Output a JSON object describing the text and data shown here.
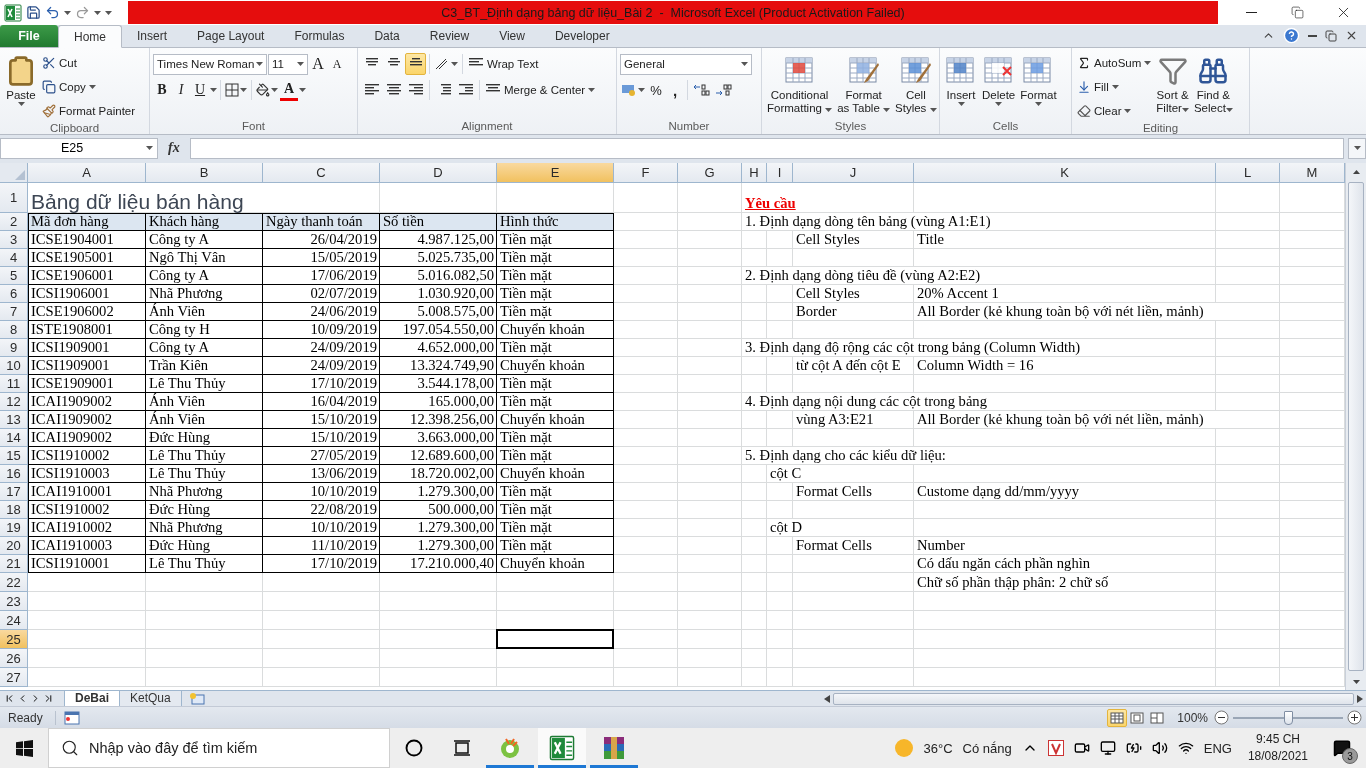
{
  "title_bar": {
    "title": "C3_BT_Định dạng bảng dữ liệu_Bài 2  -  Microsoft Excel (Product Activation Failed)"
  },
  "ribbon_tabs": [
    {
      "label": "File",
      "kind": "file",
      "selected": false
    },
    {
      "label": "Home",
      "kind": "tab",
      "selected": true
    },
    {
      "label": "Insert",
      "kind": "tab",
      "selected": false
    },
    {
      "label": "Page Layout",
      "kind": "tab",
      "selected": false
    },
    {
      "label": "Formulas",
      "kind": "tab",
      "selected": false
    },
    {
      "label": "Data",
      "kind": "tab",
      "selected": false
    },
    {
      "label": "Review",
      "kind": "tab",
      "selected": false
    },
    {
      "label": "View",
      "kind": "tab",
      "selected": false
    },
    {
      "label": "Developer",
      "kind": "tab",
      "selected": false
    }
  ],
  "ribbon": {
    "clipboard": {
      "label": "Clipboard",
      "paste": "Paste",
      "cut": "Cut",
      "copy": "Copy",
      "format_painter": "Format Painter"
    },
    "font": {
      "label": "Font",
      "font_name": "Times New Roman",
      "font_size": "11",
      "grow": "A",
      "shrink": "A",
      "bold": "B",
      "italic": "I",
      "underline": "U",
      "font_color": "A"
    },
    "alignment": {
      "label": "Alignment",
      "wrap_text": "Wrap Text",
      "merge": "Merge & Center",
      "vertical": [
        {
          "selected": false
        },
        {
          "selected": false
        },
        {
          "selected": true
        }
      ]
    },
    "number": {
      "label": "Number",
      "format": "General",
      "percent": "%",
      "comma": ","
    },
    "styles": {
      "label": "Styles",
      "buttons": [
        {
          "kind": "conditional",
          "lines": [
            "Conditional",
            "Formatting"
          ]
        },
        {
          "kind": "table",
          "lines": [
            "Format",
            "as Table"
          ]
        },
        {
          "kind": "cell",
          "lines": [
            "Cell",
            "Styles"
          ]
        }
      ]
    },
    "cells": {
      "label": "Cells",
      "buttons": [
        {
          "kind": "insert",
          "label": "Insert"
        },
        {
          "kind": "delete",
          "label": "Delete"
        },
        {
          "kind": "format",
          "label": "Format"
        }
      ]
    },
    "editing": {
      "label": "Editing",
      "autosum": "AutoSum",
      "fill": "Fill",
      "clear": "Clear",
      "buttons": [
        {
          "kind": "sort",
          "lines": [
            "Sort &",
            "Filter"
          ]
        },
        {
          "kind": "find",
          "lines": [
            "Find &",
            "Select"
          ]
        }
      ]
    }
  },
  "formula_bar": {
    "name_box": "E25",
    "function_label": "fx"
  },
  "sheet": {
    "columns": [
      {
        "label": "A",
        "selected": false
      },
      {
        "label": "B",
        "selected": false
      },
      {
        "label": "C",
        "selected": false
      },
      {
        "label": "D",
        "selected": false
      },
      {
        "label": "E",
        "selected": true
      },
      {
        "label": "F",
        "selected": false
      },
      {
        "label": "G",
        "selected": false
      },
      {
        "label": "H",
        "selected": false
      },
      {
        "label": "I",
        "selected": false
      },
      {
        "label": "J",
        "selected": false
      },
      {
        "label": "K",
        "selected": false
      },
      {
        "label": "L",
        "selected": false
      },
      {
        "label": "M",
        "selected": false
      }
    ],
    "rows": [
      {
        "number": "1",
        "selected": false,
        "cells": [
          {
            "kind": "title",
            "text": "Bảng dữ liệu bán hàng"
          },
          null,
          null,
          null,
          null,
          null,
          null,
          {
            "kind": "heading",
            "text": "Yêu cầu"
          }
        ]
      },
      {
        "number": "2",
        "selected": false,
        "cells": [
          {
            "kind": "header",
            "text": "Mã đơn hàng"
          },
          {
            "kind": "header",
            "text": "Khách hàng"
          },
          {
            "kind": "header",
            "text": "Ngày thanh toán"
          },
          {
            "kind": "header",
            "text": "Số tiền"
          },
          {
            "kind": "header",
            "text": "Hình thức"
          },
          null,
          null,
          {
            "kind": "note",
            "text": "1. Định dạng dòng tên bảng (vùng A1:E1)"
          }
        ]
      },
      {
        "number": "3",
        "selected": false,
        "cells": [
          {
            "kind": "text",
            "text": "ICSE1904001"
          },
          {
            "kind": "text",
            "text": "Công ty A"
          },
          {
            "kind": "number",
            "text": "26/04/2019"
          },
          {
            "kind": "number",
            "text": "4.987.125,00"
          },
          {
            "kind": "text",
            "text": "Tiền mặt"
          },
          null,
          null,
          null,
          null,
          {
            "kind": "note",
            "text": "Cell Styles"
          },
          {
            "kind": "note",
            "text": "Title"
          }
        ]
      },
      {
        "number": "4",
        "selected": false,
        "cells": [
          {
            "kind": "text",
            "text": "ICSE1905001"
          },
          {
            "kind": "text",
            "text": "Ngô Thị Vân"
          },
          {
            "kind": "number",
            "text": "15/05/2019"
          },
          {
            "kind": "number",
            "text": "5.025.735,00"
          },
          {
            "kind": "text",
            "text": "Tiền mặt"
          }
        ]
      },
      {
        "number": "5",
        "selected": false,
        "cells": [
          {
            "kind": "text",
            "text": "ICSE1906001"
          },
          {
            "kind": "text",
            "text": "Công ty A"
          },
          {
            "kind": "number",
            "text": "17/06/2019"
          },
          {
            "kind": "number",
            "text": "5.016.082,50"
          },
          {
            "kind": "text",
            "text": "Tiền mặt"
          },
          null,
          null,
          {
            "kind": "note",
            "text": "2. Định dạng dòng tiêu đề (vùng A2:E2)"
          }
        ]
      },
      {
        "number": "6",
        "selected": false,
        "cells": [
          {
            "kind": "text",
            "text": "ICSI1906001"
          },
          {
            "kind": "text",
            "text": "Nhã Phương"
          },
          {
            "kind": "number",
            "text": "02/07/2019"
          },
          {
            "kind": "number",
            "text": "1.030.920,00"
          },
          {
            "kind": "text",
            "text": "Tiền mặt"
          },
          null,
          null,
          null,
          null,
          {
            "kind": "note",
            "text": "Cell Styles"
          },
          {
            "kind": "note",
            "text": "20% Accent 1"
          }
        ]
      },
      {
        "number": "7",
        "selected": false,
        "cells": [
          {
            "kind": "text",
            "text": "ICSE1906002"
          },
          {
            "kind": "text",
            "text": "Ánh Viên"
          },
          {
            "kind": "number",
            "text": "24/06/2019"
          },
          {
            "kind": "number",
            "text": "5.008.575,00"
          },
          {
            "kind": "text",
            "text": "Tiền mặt"
          },
          null,
          null,
          null,
          null,
          {
            "kind": "note",
            "text": "Border"
          },
          {
            "kind": "note",
            "text": "All Border (kẻ khung toàn bộ với nét liền, mảnh)"
          }
        ]
      },
      {
        "number": "8",
        "selected": false,
        "cells": [
          {
            "kind": "text",
            "text": "ISTE1908001"
          },
          {
            "kind": "text",
            "text": "Công ty H"
          },
          {
            "kind": "number",
            "text": "10/09/2019"
          },
          {
            "kind": "number",
            "text": "197.054.550,00"
          },
          {
            "kind": "text",
            "text": "Chuyển khoản"
          }
        ]
      },
      {
        "number": "9",
        "selected": false,
        "cells": [
          {
            "kind": "text",
            "text": "ICSI1909001"
          },
          {
            "kind": "text",
            "text": "Công ty A"
          },
          {
            "kind": "number",
            "text": "24/09/2019"
          },
          {
            "kind": "number",
            "text": "4.652.000,00"
          },
          {
            "kind": "text",
            "text": "Tiền mặt"
          },
          null,
          null,
          {
            "kind": "note",
            "text": "3. Định dạng độ rộng các cột trong bảng (Column Width)"
          }
        ]
      },
      {
        "number": "10",
        "selected": false,
        "cells": [
          {
            "kind": "text",
            "text": "ICSI1909001"
          },
          {
            "kind": "text",
            "text": "Trần Kiên"
          },
          {
            "kind": "number",
            "text": "24/09/2019"
          },
          {
            "kind": "number",
            "text": "13.324.749,90"
          },
          {
            "kind": "text",
            "text": "Chuyển khoản"
          },
          null,
          null,
          null,
          null,
          {
            "kind": "note",
            "text": "từ cột A đến cột E"
          },
          {
            "kind": "note",
            "text": "Column Width = 16"
          }
        ]
      },
      {
        "number": "11",
        "selected": false,
        "cells": [
          {
            "kind": "text",
            "text": "ICSE1909001"
          },
          {
            "kind": "text",
            "text": "Lê Thu Thủy"
          },
          {
            "kind": "number",
            "text": "17/10/2019"
          },
          {
            "kind": "number",
            "text": "3.544.178,00"
          },
          {
            "kind": "text",
            "text": "Tiền mặt"
          }
        ]
      },
      {
        "number": "12",
        "selected": false,
        "cells": [
          {
            "kind": "text",
            "text": "ICAI1909002"
          },
          {
            "kind": "text",
            "text": "Ánh Viên"
          },
          {
            "kind": "number",
            "text": "16/04/2019"
          },
          {
            "kind": "number",
            "text": "165.000,00"
          },
          {
            "kind": "text",
            "text": "Tiền mặt"
          },
          null,
          null,
          {
            "kind": "note",
            "text": "4. Định dạng nội dung các cột trong bảng"
          }
        ]
      },
      {
        "number": "13",
        "selected": false,
        "cells": [
          {
            "kind": "text",
            "text": "ICAI1909002"
          },
          {
            "kind": "text",
            "text": "Ánh Viên"
          },
          {
            "kind": "number",
            "text": "15/10/2019"
          },
          {
            "kind": "number",
            "text": "12.398.256,00"
          },
          {
            "kind": "text",
            "text": "Chuyển khoản"
          },
          null,
          null,
          null,
          null,
          {
            "kind": "note",
            "text": "vùng A3:E21"
          },
          {
            "kind": "note",
            "text": "All Border (kẻ khung toàn bộ với nét liền, mảnh)"
          }
        ]
      },
      {
        "number": "14",
        "selected": false,
        "cells": [
          {
            "kind": "text",
            "text": "ICAI1909002"
          },
          {
            "kind": "text",
            "text": "Đức Hùng"
          },
          {
            "kind": "number",
            "text": "15/10/2019"
          },
          {
            "kind": "number",
            "text": "3.663.000,00"
          },
          {
            "kind": "text",
            "text": "Tiền mặt"
          }
        ]
      },
      {
        "number": "15",
        "selected": false,
        "cells": [
          {
            "kind": "text",
            "text": "ICSI1910002"
          },
          {
            "kind": "text",
            "text": "Lê Thu Thủy"
          },
          {
            "kind": "number",
            "text": "27/05/2019"
          },
          {
            "kind": "number",
            "text": "12.689.600,00"
          },
          {
            "kind": "text",
            "text": "Tiền mặt"
          },
          null,
          null,
          {
            "kind": "note",
            "text": "5. Định dạng cho các kiểu dữ liệu:"
          }
        ]
      },
      {
        "number": "16",
        "selected": false,
        "cells": [
          {
            "kind": "text",
            "text": "ICSI1910003"
          },
          {
            "kind": "text",
            "text": "Lê Thu Thủy"
          },
          {
            "kind": "number",
            "text": "13/06/2019"
          },
          {
            "kind": "number",
            "text": "18.720.002,00"
          },
          {
            "kind": "text",
            "text": "Chuyển khoản"
          },
          null,
          null,
          null,
          {
            "kind": "note",
            "text": "cột C"
          }
        ]
      },
      {
        "number": "17",
        "selected": false,
        "cells": [
          {
            "kind": "text",
            "text": "ICAI1910001"
          },
          {
            "kind": "text",
            "text": "Nhã Phương"
          },
          {
            "kind": "number",
            "text": "10/10/2019"
          },
          {
            "kind": "number",
            "text": "1.279.300,00"
          },
          {
            "kind": "text",
            "text": "Tiền mặt"
          },
          null,
          null,
          null,
          null,
          {
            "kind": "note",
            "text": "Format Cells"
          },
          {
            "kind": "note",
            "text": "Custome dạng dd/mm/yyyy"
          }
        ]
      },
      {
        "number": "18",
        "selected": false,
        "cells": [
          {
            "kind": "text",
            "text": "ICSI1910002"
          },
          {
            "kind": "text",
            "text": "Đức Hùng"
          },
          {
            "kind": "number",
            "text": "22/08/2019"
          },
          {
            "kind": "number",
            "text": "500.000,00"
          },
          {
            "kind": "text",
            "text": "Tiền mặt"
          }
        ]
      },
      {
        "number": "19",
        "selected": false,
        "cells": [
          {
            "kind": "text",
            "text": "ICAI1910002"
          },
          {
            "kind": "text",
            "text": "Nhã Phương"
          },
          {
            "kind": "number",
            "text": "10/10/2019"
          },
          {
            "kind": "number",
            "text": "1.279.300,00"
          },
          {
            "kind": "text",
            "text": "Tiền mặt"
          },
          null,
          null,
          null,
          {
            "kind": "note",
            "text": "cột D"
          }
        ]
      },
      {
        "number": "20",
        "selected": false,
        "cells": [
          {
            "kind": "text",
            "text": "ICAI1910003"
          },
          {
            "kind": "text",
            "text": "Đức Hùng"
          },
          {
            "kind": "number",
            "text": "11/10/2019"
          },
          {
            "kind": "number",
            "text": "1.279.300,00"
          },
          {
            "kind": "text",
            "text": "Tiền mặt"
          },
          null,
          null,
          null,
          null,
          {
            "kind": "note",
            "text": "Format Cells"
          },
          {
            "kind": "note",
            "text": "Number"
          }
        ]
      },
      {
        "number": "21",
        "selected": false,
        "cells": [
          {
            "kind": "text",
            "text": "ICSI1910001"
          },
          {
            "kind": "text",
            "text": "Lê Thu Thủy"
          },
          {
            "kind": "number",
            "text": "17/10/2019"
          },
          {
            "kind": "number",
            "text": "17.210.000,40"
          },
          {
            "kind": "text",
            "text": "Chuyển khoản"
          },
          null,
          null,
          null,
          null,
          null,
          {
            "kind": "note",
            "text": "Có dấu ngăn cách phần nghìn"
          }
        ]
      },
      {
        "number": "22",
        "selected": false,
        "cells": [
          null,
          null,
          null,
          null,
          null,
          null,
          null,
          null,
          null,
          null,
          {
            "kind": "note",
            "text": "Chữ số phần thập phân: 2 chữ số"
          }
        ]
      },
      {
        "number": "23",
        "selected": false
      },
      {
        "number": "24",
        "selected": false
      },
      {
        "number": "25",
        "selected": true,
        "cells": [
          null,
          null,
          null,
          null,
          {
            "kind": "active"
          }
        ]
      },
      {
        "number": "26",
        "selected": false
      },
      {
        "number": "27",
        "selected": false
      }
    ]
  },
  "sheet_tabs": [
    {
      "label": "DeBai",
      "selected": true
    },
    {
      "label": "KetQua",
      "selected": false
    }
  ],
  "status_bar": {
    "status": "Ready",
    "views": [
      {
        "selected": true
      },
      {
        "selected": false
      },
      {
        "selected": false
      }
    ],
    "zoom": "100%",
    "zoom_slider": {
      "level": 0.5
    }
  },
  "taskbar": {
    "search_placeholder": "Nhập vào đây để tìm kiếm",
    "apps": [
      {
        "kind": "browser",
        "selected": false
      },
      {
        "kind": "spreadsheet",
        "selected": true
      },
      {
        "kind": "archive",
        "selected": false
      }
    ],
    "temperature": "36°C",
    "condition": "Có nắng",
    "language": "ENG",
    "time": "9:45 CH",
    "date": "18/08/2021",
    "notifications": "3"
  }
}
